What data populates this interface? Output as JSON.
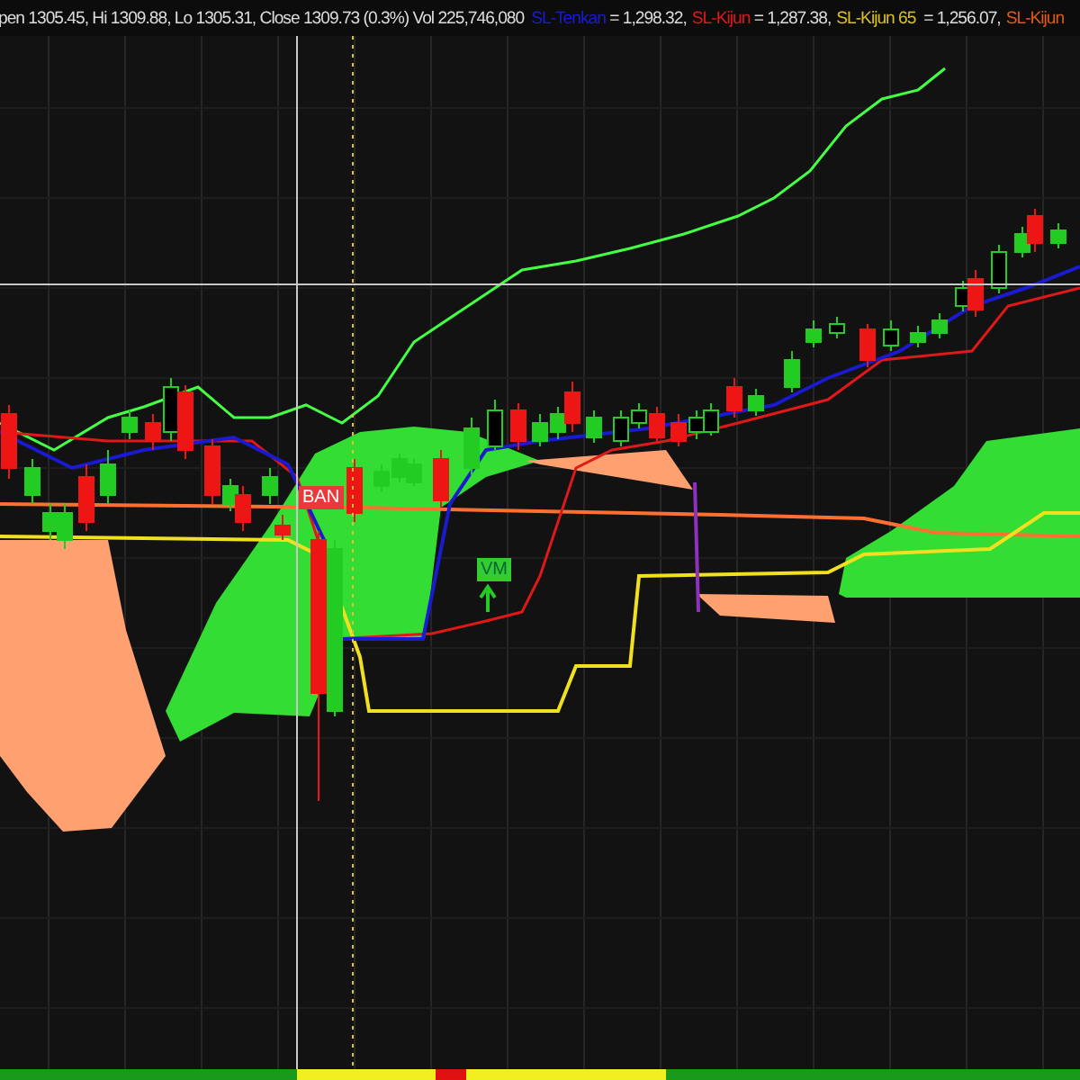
{
  "quote": {
    "text": "pen 1305.45, Hi 1309.88, Lo 1305.31, Close 1309.73 (0.3%) Vol 225,746,080"
  },
  "legend": [
    {
      "name": "SL-Tenkan",
      "value": " = 1,298.32,",
      "color": "#1a1ad0"
    },
    {
      "name": "SL-Kijun",
      "value": " = 1,287.38,",
      "color": "#e01818"
    },
    {
      "name": "SL-Kijun 65",
      "value": "  = 1,256.07,",
      "color": "#d8c020"
    },
    {
      "name": "SL-Kijun",
      "color": "#e05a14"
    }
  ],
  "chart_labels": [
    {
      "text": "BAN",
      "color": "#e83a3a"
    },
    {
      "text": "VM",
      "color": "#33cc33"
    }
  ]
}
